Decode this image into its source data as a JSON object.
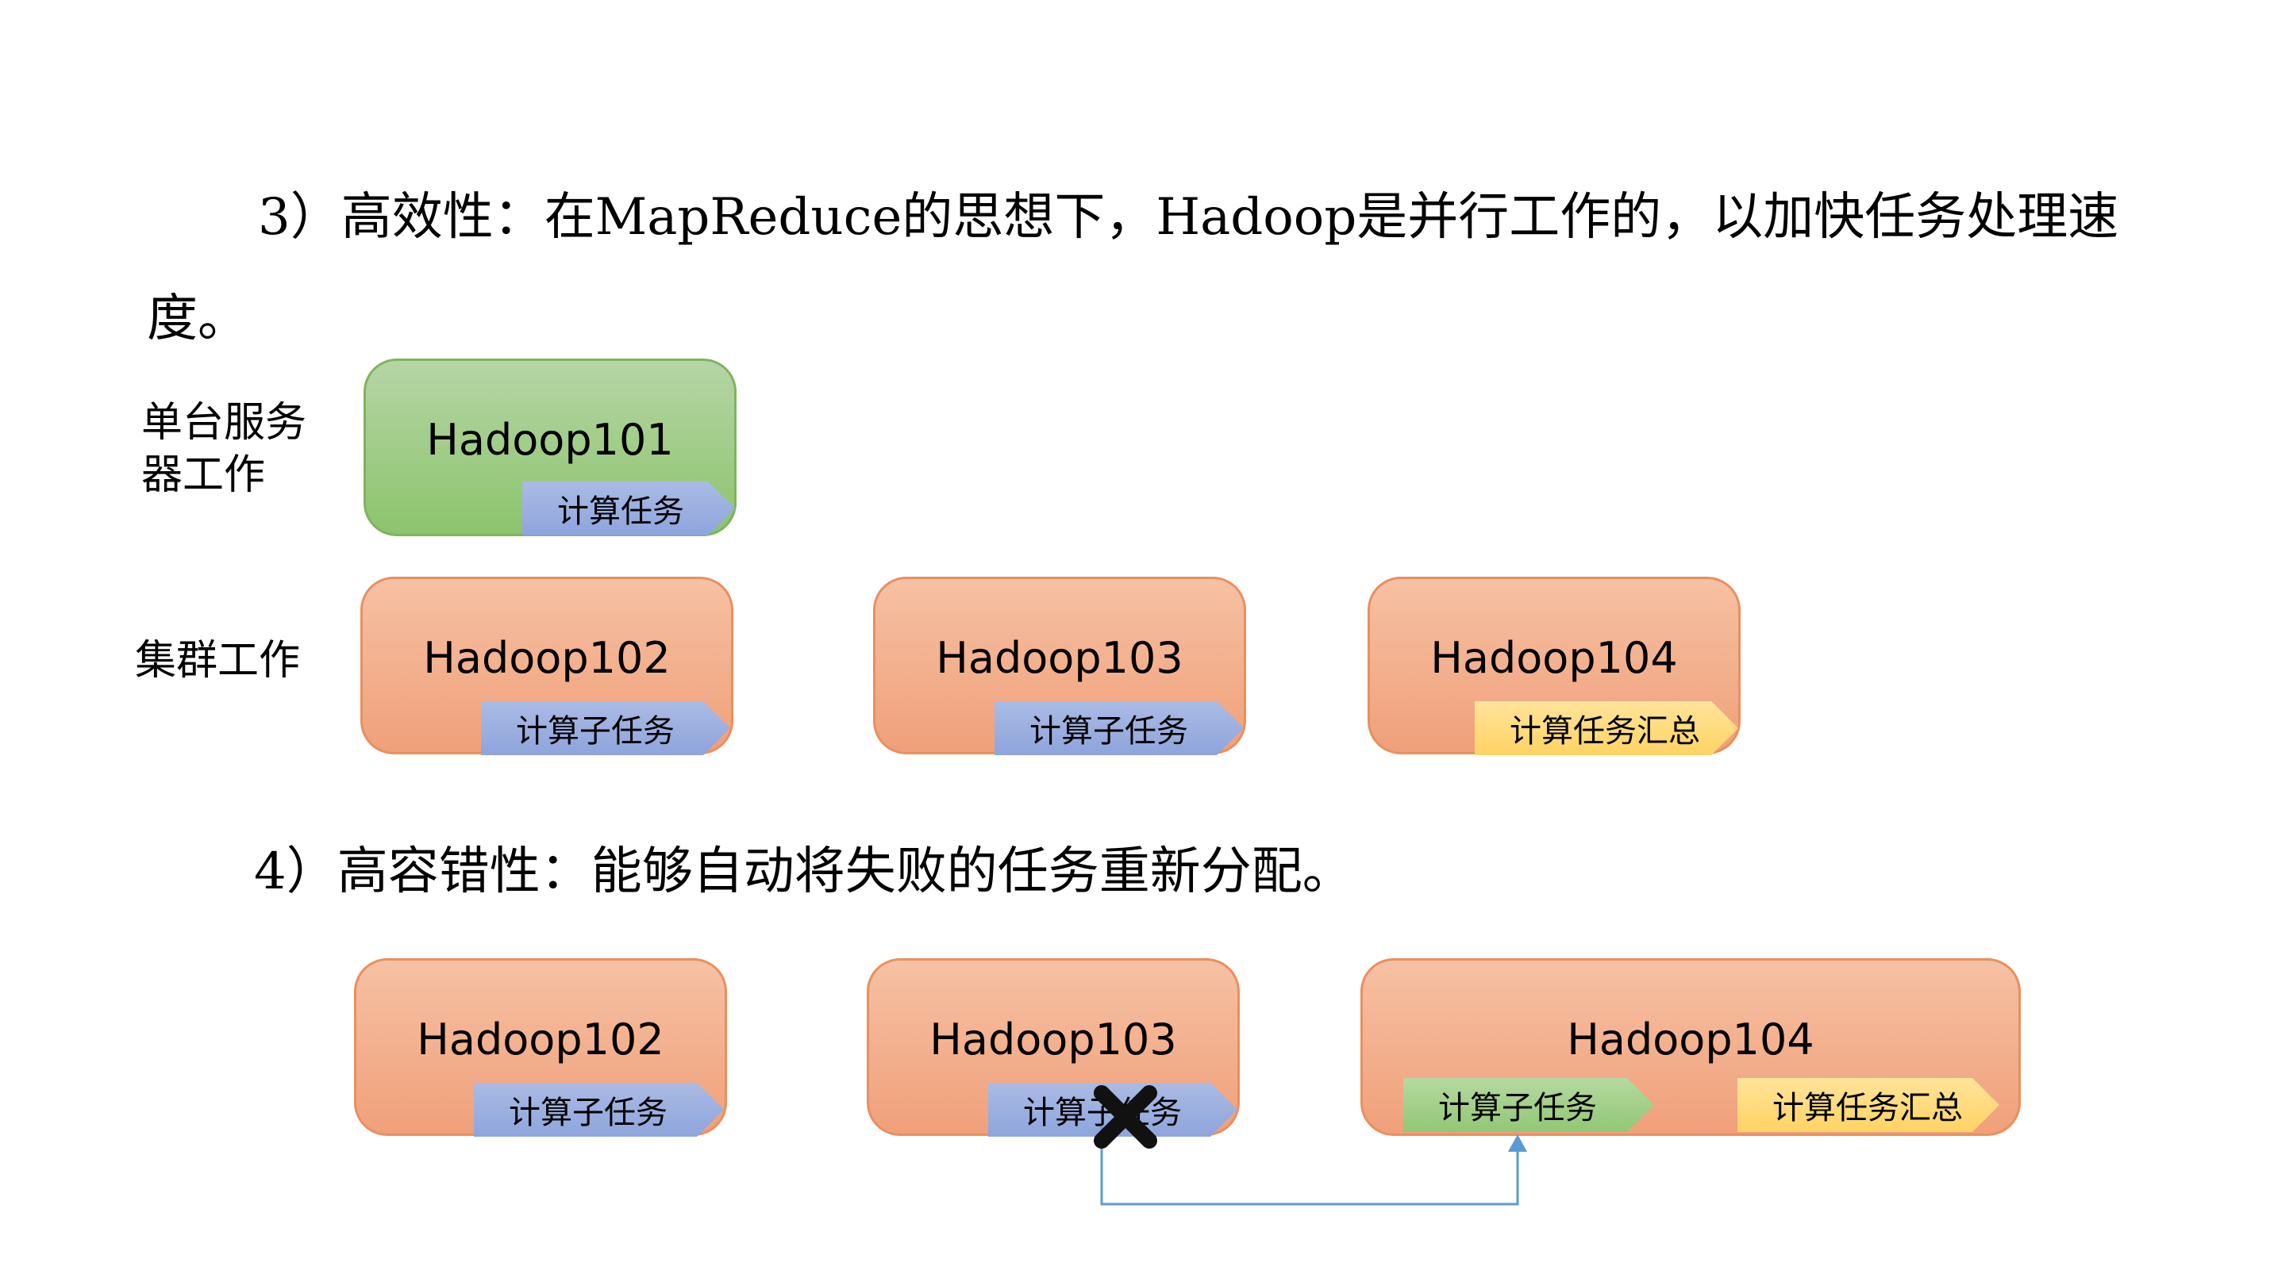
{
  "text": {
    "point3": "3）高效性：在MapReduce的思想下，Hadoop是并行工作的，以加快任务处理速度。",
    "point4": "4）高容错性：能够自动将失败的任务重新分配。"
  },
  "labels": {
    "single_server": "单台服务器工作",
    "cluster": "集群工作"
  },
  "single": {
    "title": "Hadoop101",
    "task": "计算任务"
  },
  "cluster": {
    "nodes": [
      {
        "title": "Hadoop102",
        "task": "计算子任务"
      },
      {
        "title": "Hadoop103",
        "task": "计算子任务"
      },
      {
        "title": "Hadoop104",
        "task": "计算任务汇总"
      }
    ]
  },
  "fault": {
    "nodes": [
      {
        "title": "Hadoop102",
        "task": "计算子任务"
      },
      {
        "title": "Hadoop103",
        "task": "计算子任务"
      },
      {
        "title": "Hadoop104",
        "task": "计算子任务",
        "task2": "计算任务汇总"
      }
    ]
  },
  "colors": {
    "green_node": "#8cc46c",
    "orange_node": "#f0a07a",
    "task_blue": "#8ea4dc",
    "task_yellow": "#ffd364",
    "task_green": "#92c776",
    "arrow": "#5b9bd5"
  }
}
